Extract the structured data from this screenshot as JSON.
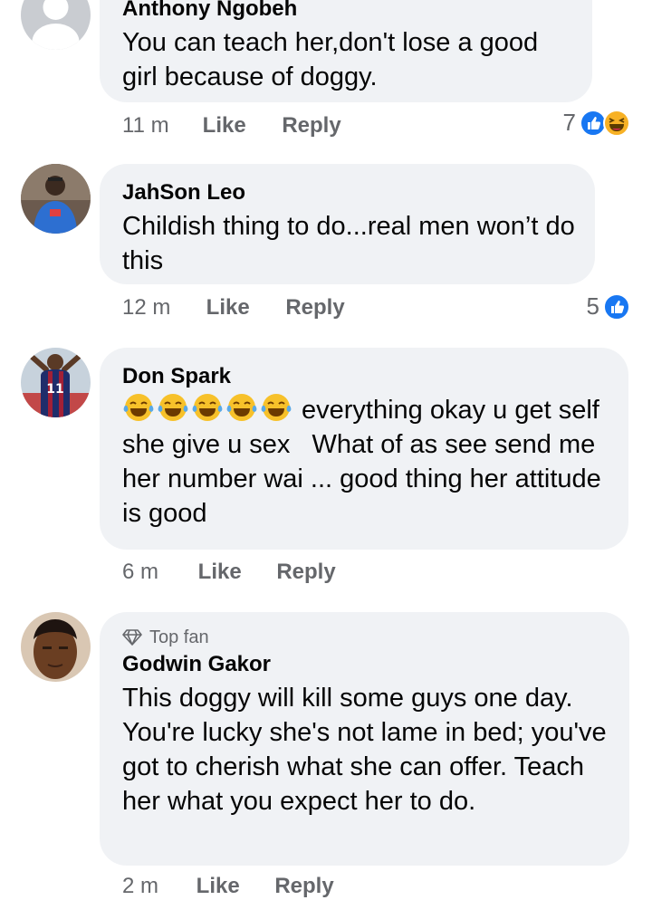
{
  "comments": [
    {
      "author": "Anthony Ngobeh",
      "text": "You can teach her,don't lose a good girl because of doggy.",
      "time": "11 m",
      "like_label": "Like",
      "reply_label": "Reply",
      "reaction_count": "7",
      "reactions": [
        "like-icon",
        "laugh-icon"
      ]
    },
    {
      "author": "JahSon Leo",
      "text": "Childish thing to do...real men won’t do this",
      "time": "12 m",
      "like_label": "Like",
      "reply_label": "Reply",
      "reaction_count": "5",
      "reactions": [
        "like-icon"
      ]
    },
    {
      "author": "Don Spark",
      "text_after_emoji": "everything okay u get self she give u sex   What of as see send me her number wai ... good thing her attitude is good",
      "emoji_count": 5,
      "time": "6 m",
      "like_label": "Like",
      "reply_label": "Reply"
    },
    {
      "badge": "Top fan",
      "author": "Godwin Gakor",
      "text": "This doggy will kill some guys one day. You're lucky she's not lame in bed; you've got to cherish what she can offer. Teach her what you expect her to do.",
      "time": "2 m",
      "like_label": "Like",
      "reply_label": "Reply"
    }
  ],
  "colors": {
    "bubble": "#f0f2f5",
    "meta_text": "#65676b",
    "like_blue": "#1877f2",
    "laugh_yellow": "#f7b125"
  }
}
